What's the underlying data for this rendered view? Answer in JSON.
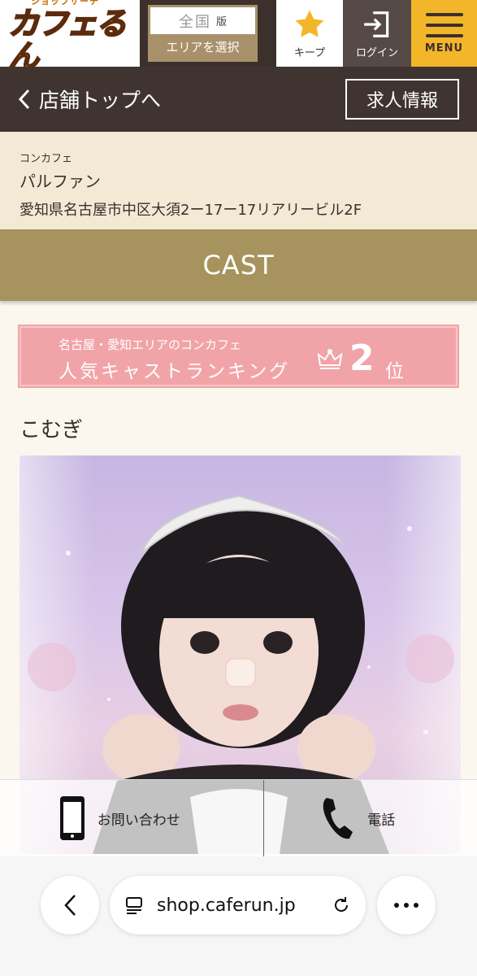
{
  "header": {
    "logo_small": "ショップサーチ",
    "logo_main": "カフェるん",
    "region_name": "全国",
    "region_suffix": "版",
    "region_select": "エリアを選択",
    "keep_label": "キープ",
    "login_label": "ログイン",
    "menu_label": "MENU"
  },
  "nav": {
    "back_label": "店舗トップへ",
    "job_label": "求人情報"
  },
  "shop": {
    "category": "コンカフェ",
    "name": "パルファン",
    "address": "愛知県名古屋市中区大須2ー17ー17リアリービル2F"
  },
  "section_title": "CAST",
  "ranking": {
    "subtitle": "名古屋・愛知エリアのコンカフェ",
    "title": "人気キャストランキング",
    "rank": "2",
    "unit": "位"
  },
  "cast": {
    "name": "こむぎ"
  },
  "contact": {
    "inquiry_label": "お問い合わせ",
    "phone_label": "電話"
  },
  "browser": {
    "url": "shop.caferun.jp"
  },
  "colors": {
    "header_bg": "#3b302c",
    "accent_gold": "#a6935e",
    "menu_yellow": "#f3b62a",
    "ranking_pink": "#f1a4a8",
    "info_bg": "#f3ead6"
  }
}
